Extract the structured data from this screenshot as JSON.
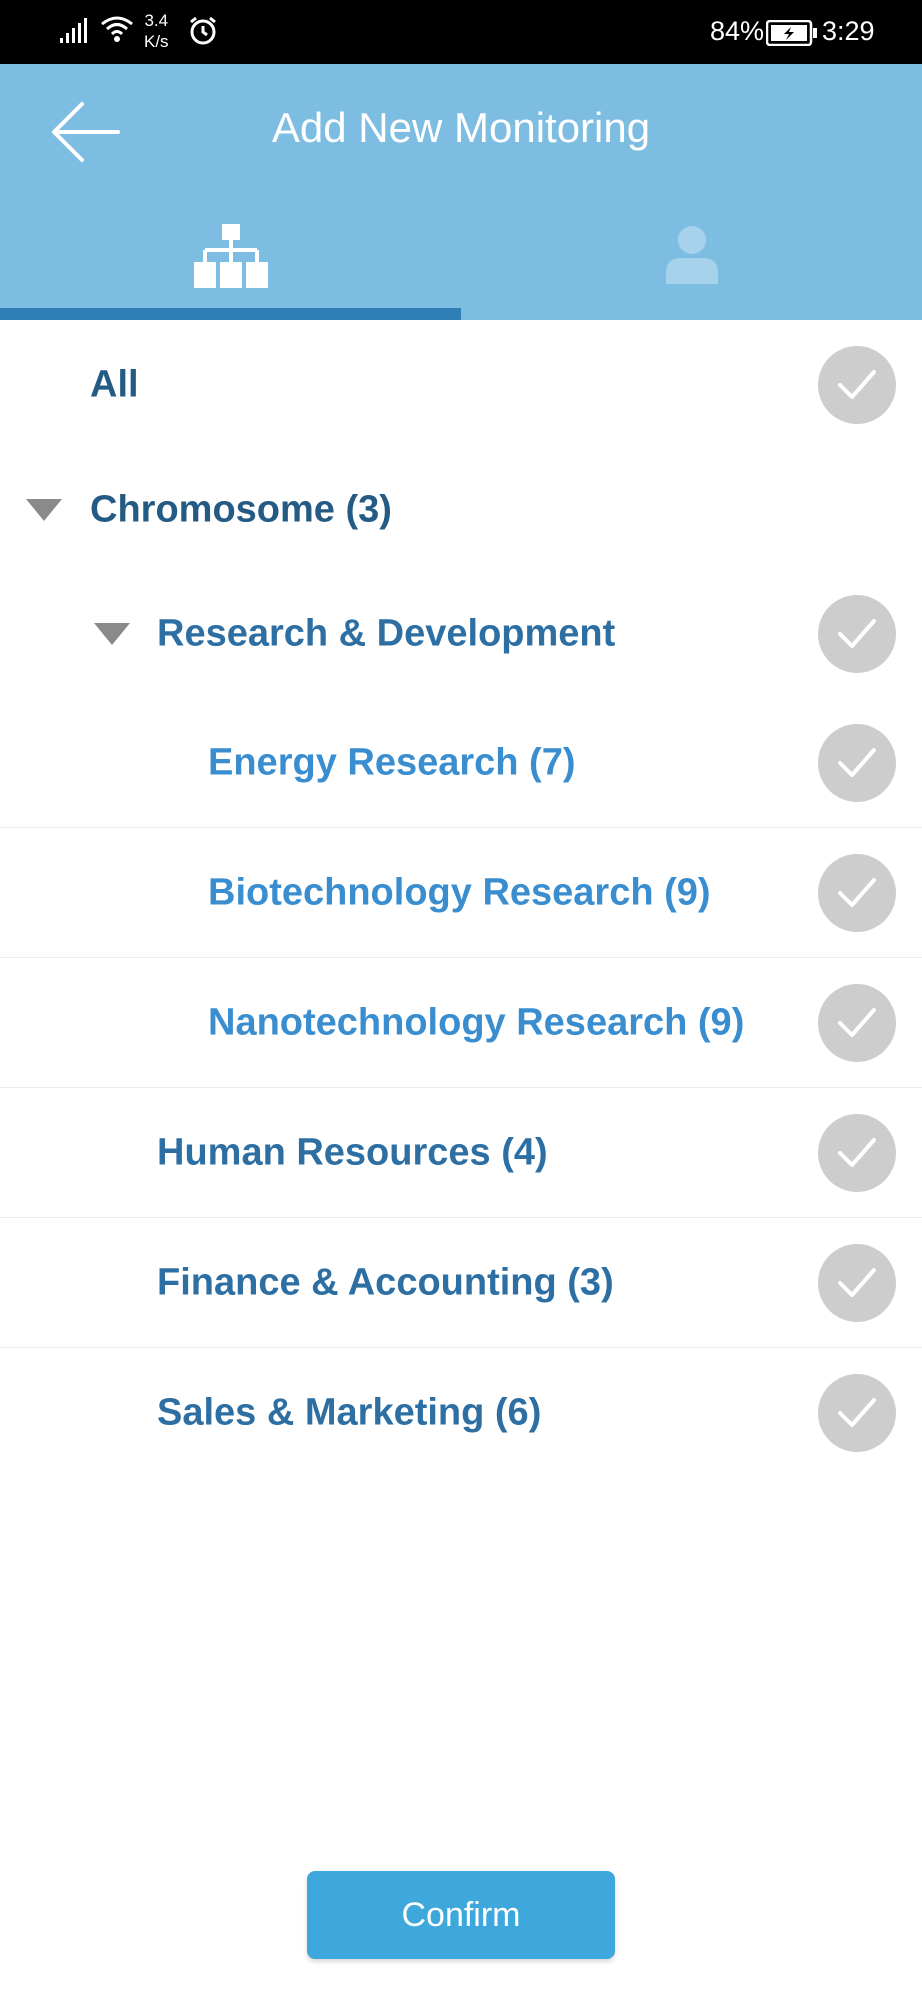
{
  "status_bar": {
    "network_speed_value": "3.4",
    "network_speed_unit": "K/s",
    "battery_percent": "84%",
    "time": "3:29"
  },
  "header": {
    "title": "Add New Monitoring",
    "tabs": [
      {
        "icon": "org-chart-icon",
        "active": true
      },
      {
        "icon": "person-icon",
        "active": false
      }
    ]
  },
  "colors": {
    "header_bg": "#7ebde2",
    "tab_indicator": "#2f7fb7",
    "label_dark": "#245b84",
    "label_mid": "#2d6fa3",
    "label_light": "#3a8ecf",
    "check_circle": "#cdcdcd",
    "confirm_bg": "#3ea7db"
  },
  "tree": {
    "all_label": "All",
    "chromosome_label": "Chromosome (3)",
    "rnd_label": "Research & Development",
    "rnd_children": [
      {
        "label": "Energy Research (7)"
      },
      {
        "label": "Biotechnology Research (9)"
      },
      {
        "label": "Nanotechnology Research (9)"
      }
    ],
    "departments": [
      {
        "label": "Human Resources (4)"
      },
      {
        "label": "Finance & Accounting (3)"
      },
      {
        "label": "Sales & Marketing (6)"
      }
    ]
  },
  "confirm_label": "Confirm"
}
